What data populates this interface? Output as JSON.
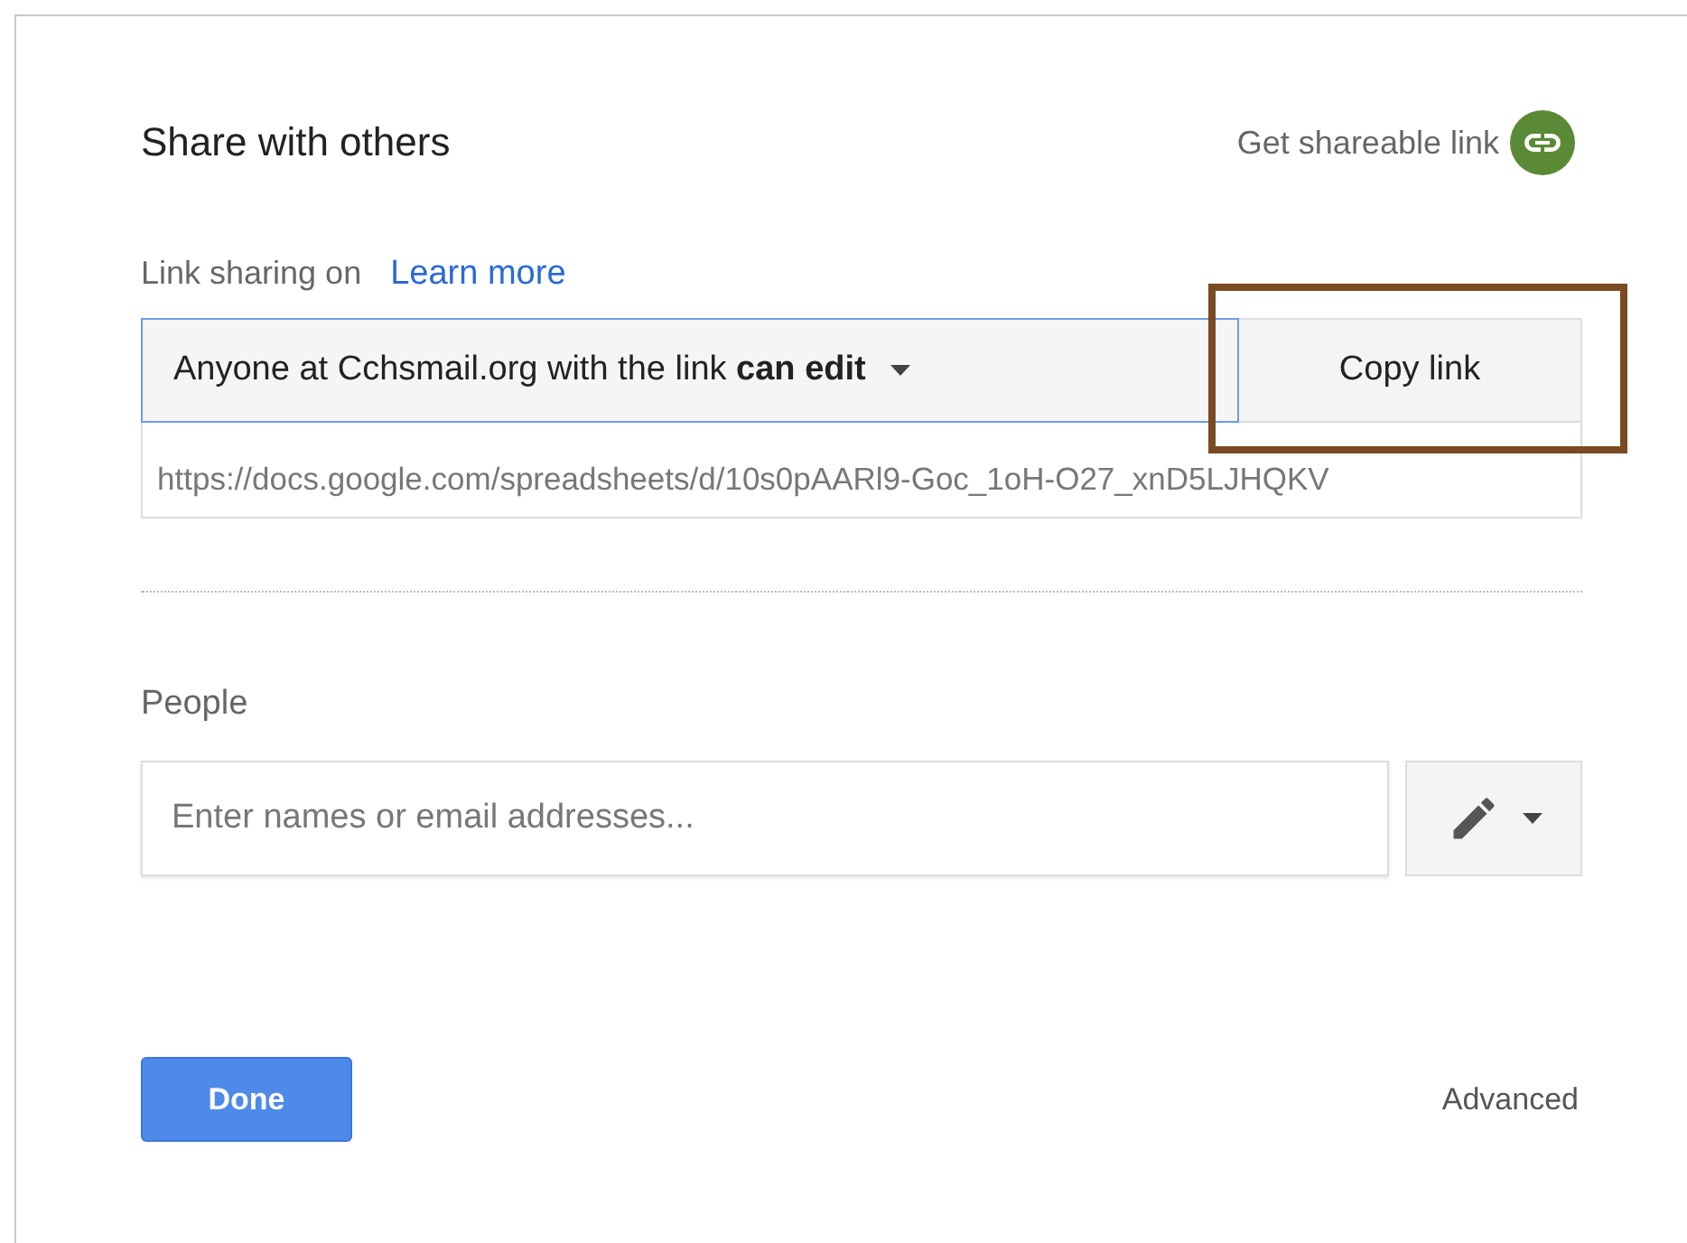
{
  "dialog": {
    "title": "Share with others",
    "shareable_link": {
      "label": "Get shareable link",
      "on": true
    }
  },
  "link_sharing": {
    "label": "Link sharing on",
    "learn_more": "Learn more",
    "access": "Anyone at Cchsmail.org with the link **can edit**",
    "copy_button": "Copy link",
    "copy_highlighted": true,
    "url": "https://docs.google.com/spreadsheets/d/10s0pAARl9-Goc_1oH-O27_xnD5LJHQKV"
  },
  "people": {
    "label": "People",
    "placeholder": "Enter names or email addresses..."
  },
  "buttons": {
    "done": "Done",
    "advanced": "Advanced"
  }
}
